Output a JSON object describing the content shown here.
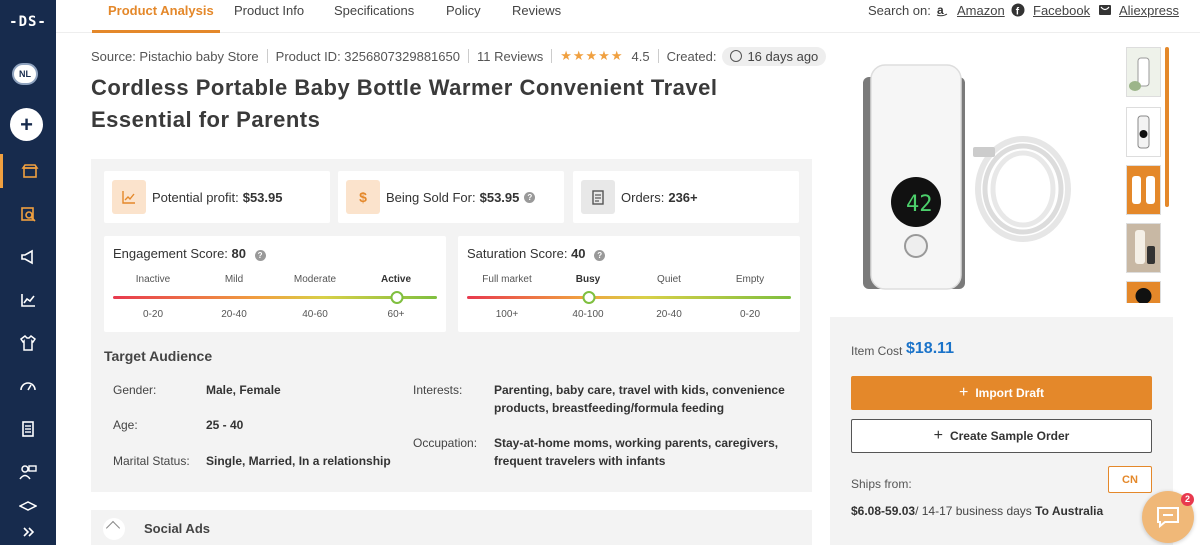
{
  "sidebar": {
    "logo": "-DS-",
    "avatar": "NL",
    "add_label": "+"
  },
  "tabs": [
    {
      "label": "Product Analysis"
    },
    {
      "label": "Product Info"
    },
    {
      "label": "Specifications"
    },
    {
      "label": "Policy"
    },
    {
      "label": "Reviews"
    }
  ],
  "search_on": {
    "label": "Search on:",
    "links": [
      {
        "label": "Amazon",
        "icon": "amazon-icon"
      },
      {
        "label": "Facebook",
        "icon": "facebook-icon"
      },
      {
        "label": "Aliexpress",
        "icon": "aliexpress-icon"
      }
    ]
  },
  "meta": {
    "source": "Source: Pistachio baby Store",
    "product_id": "Product ID: 3256807329881650",
    "reviews": "11 Reviews",
    "rating": "4.5",
    "rating_value": 4.5,
    "created_label": "Created:",
    "created_value": "16 days ago"
  },
  "title": "Cordless Portable Baby Bottle Warmer Convenient Travel Essential for Parents",
  "stats": {
    "profit_label": "Potential profit:",
    "profit_value": "$53.95",
    "sold_label": "Being Sold For:",
    "sold_value": "$53.95",
    "orders_label": "Orders:",
    "orders_value": "236+"
  },
  "engagement": {
    "label": "Engagement Score:",
    "value": "80",
    "level_fraction": 0.875,
    "levels": [
      "Inactive",
      "Mild",
      "Moderate",
      "Active"
    ],
    "ranges": [
      "0-20",
      "20-40",
      "40-60",
      "60+"
    ],
    "active_index": 3
  },
  "saturation": {
    "label": "Saturation Score:",
    "value": "40",
    "level_fraction": 0.375,
    "levels": [
      "Full market",
      "Busy",
      "Quiet",
      "Empty"
    ],
    "ranges": [
      "100+",
      "40-100",
      "20-40",
      "0-20"
    ],
    "active_index": 1
  },
  "audience": {
    "title": "Target Audience",
    "gender_label": "Gender:",
    "gender_value": "Male, Female",
    "age_label": "Age:",
    "age_value": "25 - 40",
    "marital_label": "Marital Status:",
    "marital_value": "Single, Married, In a relationship",
    "interests_label": "Interests:",
    "interests_value": "Parenting, baby care, travel with kids, convenience products, breastfeeding/formula feeding",
    "occupation_label": "Occupation:",
    "occupation_value": "Stay-at-home moms, working parents, caregivers, frequent travelers with infants"
  },
  "social_ads": "Social Ads",
  "pricing": {
    "item_cost_label": "Item Cost",
    "item_cost_value": "$18.11",
    "import_label": "Import Draft",
    "sample_label": "Create Sample Order",
    "ships_from_label": "Ships from:",
    "country": "CN",
    "shipping_price": "$6.08-59.03",
    "shipping_days": "/ 14-17 business days",
    "shipping_dest": "To Australia"
  },
  "chat": {
    "badge": "2"
  },
  "colors": {
    "accent": "#e4882a",
    "sidebar": "#172b4d",
    "price": "#1a73c9"
  }
}
